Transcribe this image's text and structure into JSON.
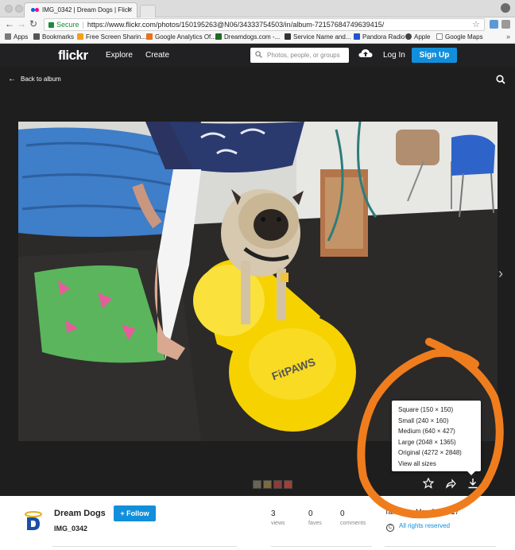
{
  "browser": {
    "tab_title": "IMG_0342 | Dream Dogs | Flick",
    "tab_close": "×",
    "secure_label": "Secure",
    "url_host": "https://www.flickr.com",
    "url_path": "/photos/150195263@N06/34333754503/in/album-72157684749639415/",
    "bookmarks": [
      {
        "label": "Apps",
        "color": "#7a7a7a"
      },
      {
        "label": "Bookmarks",
        "color": "#555555"
      },
      {
        "label": "Free Screen Sharin...",
        "color": "#f2a019"
      },
      {
        "label": "Google Analytics Of...",
        "color": "#e8711c"
      },
      {
        "label": "Dreamdogs.com -...",
        "color": "#1f6b1f"
      },
      {
        "label": "Service Name and...",
        "color": "#333333"
      },
      {
        "label": "Pandora Radio",
        "color": "#2255cc"
      },
      {
        "label": "Apple",
        "color": "#444444"
      },
      {
        "label": "Google Maps",
        "color": "#888888"
      }
    ],
    "more": "»"
  },
  "header": {
    "logo": "flickr",
    "nav": [
      "Explore",
      "Create"
    ],
    "search_placeholder": "Photos, people, or groups",
    "login": "Log In",
    "signup": "Sign Up"
  },
  "viewer": {
    "back_arrow": "←",
    "back_label": "Back to album",
    "next_arrow": "›",
    "download_menu": [
      "Square (150 × 150)",
      "Small (240 × 160)",
      "Medium (640 × 427)",
      "Large (2048 × 1365)",
      "Original (4272 × 2848)",
      "View all sizes"
    ],
    "ball_text": "FitPAWS"
  },
  "info": {
    "owner": "Dream Dogs",
    "follow": "+ Follow",
    "photo_title": "IMG_0342",
    "stats": [
      {
        "value": "3",
        "label": "views"
      },
      {
        "value": "0",
        "label": "faves"
      },
      {
        "value": "0",
        "label": "comments"
      }
    ],
    "taken": "Taken on May 26, 2017",
    "rights_symbol": "C",
    "rights": "All rights reserved"
  },
  "colors": {
    "flickr_blue": "#128fdc",
    "header_bg": "#212124",
    "annotation": "#f07d1d"
  }
}
